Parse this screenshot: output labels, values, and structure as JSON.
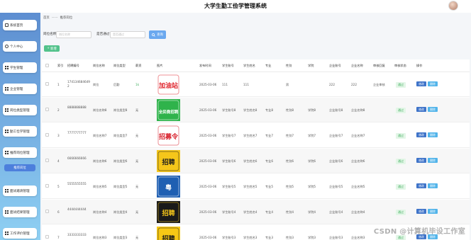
{
  "header": {
    "title": "大学生勤工俭学管理系统"
  },
  "sidebar": {
    "items": [
      {
        "label": "系统首页",
        "icon": "home-icon"
      },
      {
        "label": "个人中心",
        "icon": "user-icon"
      },
      {
        "label": "学生管理",
        "icon": "grid-icon"
      },
      {
        "label": "企业管理",
        "icon": "grid-icon"
      },
      {
        "label": "岗位类型管理",
        "icon": "grid-icon"
      },
      {
        "label": "勤工俭学管理",
        "icon": "grid-icon"
      },
      {
        "label": "推荐岗位管理",
        "icon": "grid-icon"
      },
      {
        "label": "推荐岗位",
        "icon": ""
      },
      {
        "label": "面试邀请管理",
        "icon": "grid-icon"
      },
      {
        "label": "面试结果管理",
        "icon": "grid-icon"
      },
      {
        "label": "工作评价管理",
        "icon": "grid-icon"
      }
    ]
  },
  "breadcrumb": {
    "home": "首页",
    "sep": "——",
    "current": "推荐岗位"
  },
  "search": {
    "field1_label": "岗位名称",
    "field1_placeholder": "岗位名称",
    "field2_label": "是否通过",
    "field2_placeholder": "是否通过",
    "button_label": "查询"
  },
  "actions": {
    "add_label": "新增"
  },
  "table": {
    "headers": [
      "索引",
      "招聘编号",
      "岗位名称",
      "岗位类型",
      "薪资",
      "图片",
      "发布时间",
      "学生账号",
      "学生姓名",
      "专业",
      "性别",
      "学院",
      "企业账号",
      "企业名称",
      "审核回复",
      "审核状态",
      "操作"
    ],
    "rows": [
      {
        "index": "1",
        "code": "1741346846492",
        "name": "岗位",
        "type": "后勤",
        "salary": "1k",
        "date": "2025-03-06",
        "account": "111",
        "student": "111",
        "major": "",
        "gender": "男",
        "college": "",
        "company_account": "222",
        "company": "222",
        "reply": "企业审核",
        "status": "通过"
      },
      {
        "index": "2",
        "code": "8888888888",
        "name": "岗位名称8",
        "type": "岗位类型8",
        "salary": "无",
        "date": "2025-03-06",
        "account": "学生账号8",
        "student": "学生姓名8",
        "major": "专业8",
        "gender": "性别8",
        "college": "学院8",
        "company_account": "企业账号8",
        "company": "企业名称8",
        "reply": "",
        "status": "通过"
      },
      {
        "index": "3",
        "code": "7777777777",
        "name": "岗位名称7",
        "type": "岗位类型7",
        "salary": "无",
        "date": "2025-03-06",
        "account": "学生账号7",
        "student": "学生姓名7",
        "major": "专业7",
        "gender": "性别7",
        "college": "学院7",
        "company_account": "企业账号7",
        "company": "企业名称7",
        "reply": "",
        "status": "通过"
      },
      {
        "index": "4",
        "code": "6666666666",
        "name": "岗位名称6",
        "type": "岗位类型6",
        "salary": "无",
        "date": "2025-03-06",
        "account": "学生账号6",
        "student": "学生姓名6",
        "major": "专业6",
        "gender": "性别6",
        "college": "学院6",
        "company_account": "企业账号6",
        "company": "企业名称6",
        "reply": "",
        "status": "通过"
      },
      {
        "index": "5",
        "code": "5555555555",
        "name": "岗位名称5",
        "type": "岗位类型5",
        "salary": "无",
        "date": "2025-03-06",
        "account": "学生账号5",
        "student": "学生姓名5",
        "major": "专业5",
        "gender": "性别5",
        "college": "学院5",
        "company_account": "企业账号5",
        "company": "企业名称5",
        "reply": "",
        "status": "通过"
      },
      {
        "index": "6",
        "code": "4444444444",
        "name": "岗位名称4",
        "type": "岗位类型4",
        "salary": "无",
        "date": "2025-03-06",
        "account": "学生账号4",
        "student": "学生姓名4",
        "major": "专业4",
        "gender": "性别4",
        "college": "学院4",
        "company_account": "企业账号4",
        "company": "企业名称4",
        "reply": "",
        "status": "通过"
      },
      {
        "index": "7",
        "code": "3333333333",
        "name": "岗位名称3",
        "type": "岗位类型3",
        "salary": "无",
        "date": "2025-03-06",
        "account": "学生账号3",
        "student": "学生姓名3",
        "major": "专业3",
        "gender": "性别3",
        "college": "学院3",
        "company_account": "企业账号3",
        "company": "企业名称3",
        "reply": "",
        "status": "通过"
      }
    ],
    "edit_label": "修改",
    "delete_label": "删除"
  },
  "images": [
    {
      "text": "加油站",
      "bg": "#ffffff",
      "fg": "#e0252d"
    },
    {
      "text": "全民微招聘",
      "bg": "#2fb34b",
      "fg": "#ffffff"
    },
    {
      "text": "招募令",
      "bg": "#ffffff",
      "fg": "#d8202b"
    },
    {
      "text": "招聘",
      "bg": "#f5c61a",
      "fg": "#1d1d1d"
    },
    {
      "text": "粤",
      "bg": "#1f5fb2",
      "fg": "#ffffff"
    },
    {
      "text": "招聘",
      "bg": "#1a1a1a",
      "fg": "#f5c61a"
    },
    {
      "text": "招聘",
      "bg": "#f7c815",
      "fg": "#1a1a1a"
    }
  ],
  "watermark": "CSDN @计算机毕设工作室",
  "colors": {
    "sidebar_top": "#5d8ed1",
    "sidebar_bottom": "#8fd0f3",
    "search_button": "#6aa8ef",
    "add_button": "#52c28b",
    "edit_button": "#3f74c9",
    "delete_button": "#52b4ea",
    "pass_badge": "#3fae5d"
  }
}
